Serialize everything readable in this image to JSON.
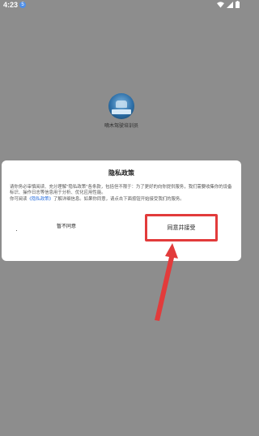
{
  "status_bar": {
    "time": "4:23",
    "notification_badge": "5"
  },
  "splash": {
    "app_name": "嘀木驾驶培训员"
  },
  "dialog": {
    "title": "隐私政策",
    "body_part1": "请你务必审慎阅读、充分理解\"隐私政策\"各条款，包括但不限于：为了更好的向你提供服务，我们需要收集你的设备标识、操作日志等信息用于分析、优化应用性能。",
    "body_part2": "你可阅读",
    "policy_link": "《隐私政策》",
    "body_part3": "了解详细信息。如果你同意，请点击下面按钮开始接受我们的服务。",
    "disagree_label": "暂不同意",
    "agree_label": "同意并接受"
  },
  "colors": {
    "highlight": "#e23b3b",
    "link": "#2b6fdc",
    "overlay": "#8d8d8d"
  }
}
